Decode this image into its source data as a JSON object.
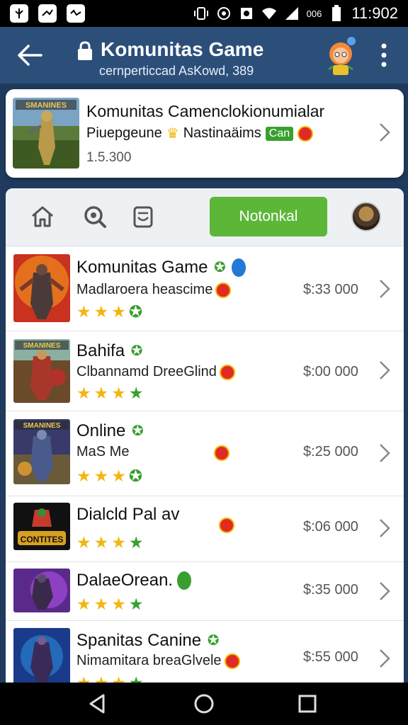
{
  "status": {
    "left_icons": [
      "nature-icon",
      "bird-icon",
      "signal-app-icon"
    ],
    "sim": "006",
    "time": "11:902"
  },
  "appbar": {
    "title": "Komunitas Game",
    "subtitle": "cernperticcad AsKowd, 389"
  },
  "featured": {
    "title": "Komunitas Camenclokionumialar",
    "subtitle": "Piuepgeune",
    "subtitle2": "Nastinaäims",
    "badge": "Can",
    "count": "1.5.300"
  },
  "tabs": {
    "icons": [
      "home-icon",
      "chat-search-icon",
      "bag-icon"
    ],
    "active_label": "Notonkal"
  },
  "games": [
    {
      "name": "Komunitas Game",
      "desc": "Madlaroera heascime",
      "price": "$:33 000",
      "stars": [
        "gold",
        "gold",
        "gold",
        "green-outline"
      ]
    },
    {
      "name": "Bahifa",
      "desc": "Clbannamd DreeGlind",
      "price": "$:00 000",
      "stars": [
        "gold",
        "gold",
        "gold",
        "green"
      ]
    },
    {
      "name": "Online",
      "desc": "MaS Me",
      "price": "$:25 000",
      "stars": [
        "gold",
        "gold",
        "gold",
        "green-outline"
      ]
    },
    {
      "name": "Dialcld Pal av",
      "desc": "",
      "price": "$:06 000",
      "stars": [
        "gold",
        "gold",
        "gold",
        "green"
      ]
    },
    {
      "name": "DalaeOrean.",
      "desc": "",
      "price": "$:35 000",
      "stars": [
        "gold",
        "gold",
        "gold",
        "green"
      ]
    },
    {
      "name": "Spanitas Canine",
      "desc": "Nimamitara breaGlvele",
      "price": "$:55 000",
      "stars": [
        "gold",
        "gold",
        "gold",
        "green"
      ]
    }
  ],
  "thumb_text": {
    "featured": "SMANINES",
    "game2": "SMANINES",
    "game3": "SMANINES",
    "game4": "CONTITES"
  },
  "colors": {
    "appbar": "#2c4f7a",
    "accent_green": "#5cb738",
    "star_gold": "#f2b614",
    "star_green": "#39a02f"
  }
}
